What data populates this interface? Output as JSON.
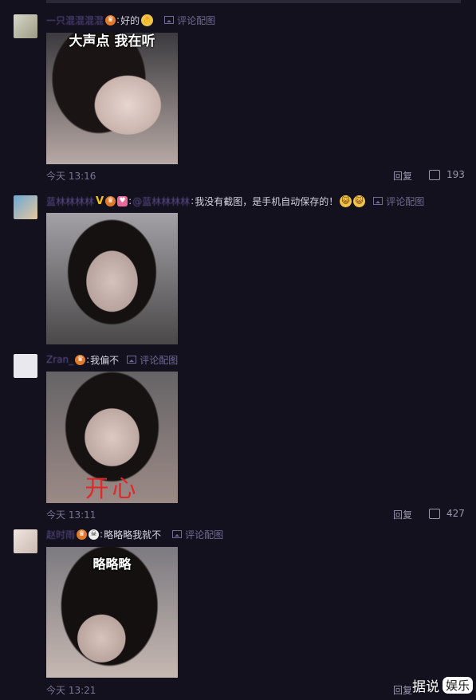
{
  "comments": [
    {
      "username": "一只混混混混",
      "text": "好的",
      "pic_label": "评论配图",
      "caption": "大声点 我在听",
      "time": "今天 13:16",
      "reply": "回复",
      "likes": "193"
    },
    {
      "username": "蓝林林林林",
      "mention": "@蓝林林林林",
      "text": "我没有截图，是手机自动保存的！",
      "pic_label": "评论配图"
    },
    {
      "username": "Zran_",
      "text": "我偏不",
      "pic_label": "评论配图",
      "caption": "开心",
      "time": "今天 13:11",
      "reply": "回复",
      "likes": "427"
    },
    {
      "username": "赵时雨",
      "text": "略略略我就不",
      "pic_label": "评论配图",
      "caption": "略略略",
      "time": "今天 13:21",
      "reply": "回复"
    }
  ],
  "watermark": {
    "prefix": "据说",
    "box": "娱乐"
  },
  "icons": [
    "ok-hand-emoji",
    "cat-face-emoji",
    "crown-badge",
    "vip-v-badge",
    "skull-badge",
    "picture-icon",
    "thumbs-up-icon"
  ]
}
